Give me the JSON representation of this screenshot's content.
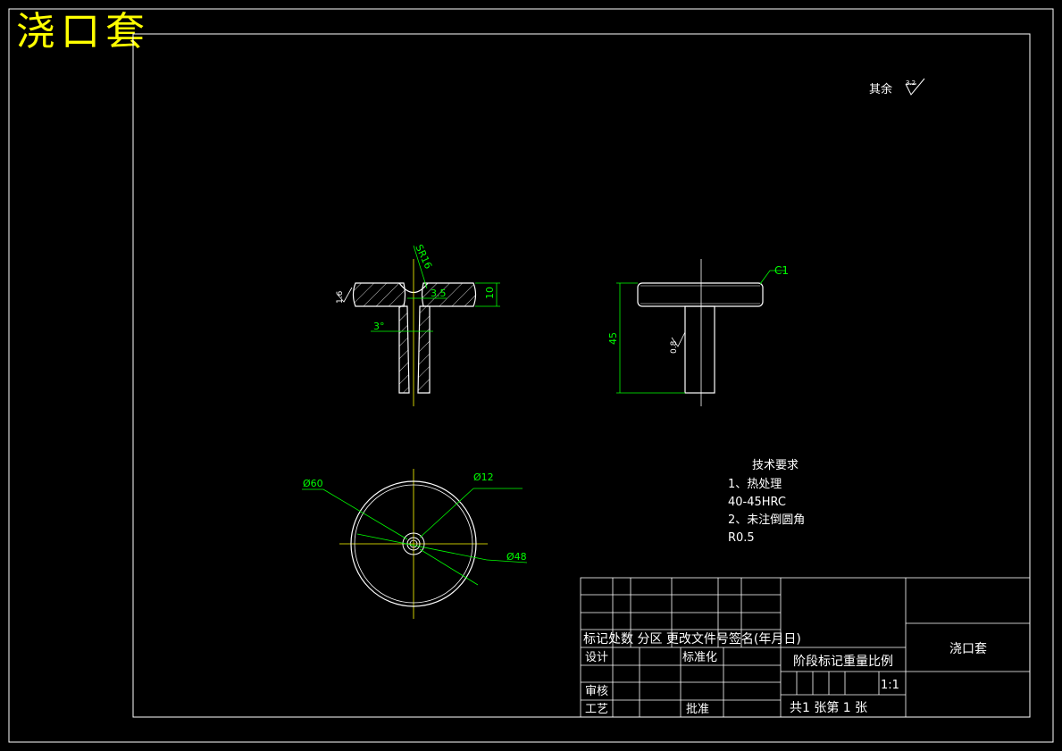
{
  "title": "浇口套",
  "roughness": {
    "label": "其余",
    "value": "3.2"
  },
  "dims": {
    "sr": "SR16",
    "thickness": "10",
    "hole": "3.5",
    "taper": "3°",
    "rough_left": "1.6",
    "height": "45",
    "rough_right": "0.8",
    "chamfer": "C1",
    "d60": "Ø60",
    "d12": "Ø12",
    "d48": "Ø48"
  },
  "tech": {
    "heading": "技术要求",
    "lines": [
      "1、热处理",
      "40-45HRC",
      "2、未注倒圆角",
      "R0.5"
    ]
  },
  "title_block": {
    "rev_header": "标记处数 分区 更改文件号签名(年月日)",
    "design": "设计",
    "standard": "标准化",
    "review": "审核",
    "process": "工艺",
    "approve": "批准",
    "stage": "阶段标记重量比例",
    "scale": "1:1",
    "sheets": "共1    张第 1 张",
    "part_name": "浇口套"
  },
  "colors": {
    "line": "#ffffff",
    "dim": "#00ff00",
    "title": "#ffff00",
    "center": "#ffff00"
  }
}
